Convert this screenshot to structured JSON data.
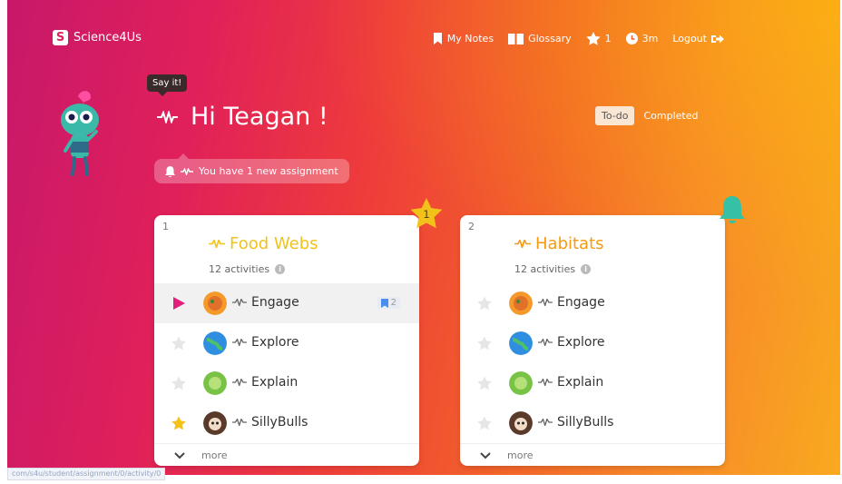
{
  "app": {
    "brand_letter": "S",
    "brand_name": "Science4Us"
  },
  "nav": {
    "notes_label": "My Notes",
    "glossary_label": "Glossary",
    "stars_count": "1",
    "timer_label": "3m",
    "logout_label": "Logout"
  },
  "tooltip": {
    "text": "Say it!"
  },
  "greeting": {
    "text": "Hi Teagan !"
  },
  "notice": {
    "text": "You have 1 new assignment"
  },
  "filters": {
    "todo_label": "To-do",
    "completed_label": "Completed"
  },
  "cards": [
    {
      "number": "1",
      "title": "Food Webs",
      "subtitle": "12 activities",
      "title_color": "#f0c21a",
      "badge": "1",
      "rows": [
        {
          "label": "Engage",
          "state": "play",
          "bookmark_count": "2"
        },
        {
          "label": "Explore",
          "state": "empty-star"
        },
        {
          "label": "Explain",
          "state": "empty-star"
        },
        {
          "label": "SillyBulls",
          "state": "gold-star"
        }
      ],
      "more_label": "more"
    },
    {
      "number": "2",
      "title": "Habitats",
      "subtitle": "12 activities",
      "title_color": "#f59a12",
      "rows": [
        {
          "label": "Engage",
          "state": "empty-star"
        },
        {
          "label": "Explore",
          "state": "empty-star"
        },
        {
          "label": "Explain",
          "state": "empty-star"
        },
        {
          "label": "SillyBulls",
          "state": "empty-star"
        }
      ],
      "more_label": "more"
    }
  ],
  "status_bar": {
    "url": "com/s4u/student/assignment/0/activity/0"
  },
  "colors": {
    "gradient": [
      "#c8186a",
      "#ee3b3b",
      "#f7882a",
      "#f9a91f"
    ],
    "play": "#e0207a",
    "gold_star": "#f2c21a",
    "bell": "#35c1a5"
  }
}
